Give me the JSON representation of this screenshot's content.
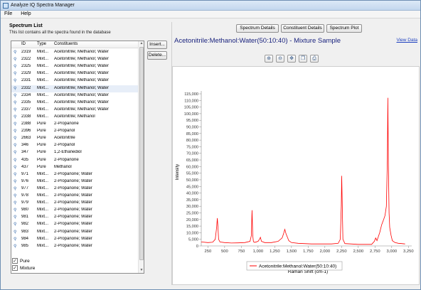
{
  "window": {
    "title": "Analyze IQ Spectra Manager"
  },
  "menu": [
    "File",
    "Help"
  ],
  "spectrum_list": {
    "header": "Spectrum List",
    "description": "This list contains all the spectra found in the database",
    "columns": [
      "ID",
      "Type",
      "Constituents"
    ],
    "rows": [
      {
        "id": "2319",
        "type": "Mixt...",
        "constituents": "Acetonitrile; Methanol; Water"
      },
      {
        "id": "2322",
        "type": "Mixt...",
        "constituents": "Acetonitrile; Methanol; Water"
      },
      {
        "id": "2325",
        "type": "Mixt...",
        "constituents": "Acetonitrile; Methanol; Water"
      },
      {
        "id": "2329",
        "type": "Mixt...",
        "constituents": "Acetonitrile; Methanol; Water"
      },
      {
        "id": "2331",
        "type": "Mixt...",
        "constituents": "Acetonitrile; Methanol; Water"
      },
      {
        "id": "2332",
        "type": "Mixt...",
        "constituents": "Acetonitrile; Methanol; Water"
      },
      {
        "id": "2334",
        "type": "Mixt...",
        "constituents": "Acetonitrile; Methanol; Water"
      },
      {
        "id": "2335",
        "type": "Mixt...",
        "constituents": "Acetonitrile; Methanol; Water"
      },
      {
        "id": "2337",
        "type": "Mixt...",
        "constituents": "Acetonitrile; Methanol; Water"
      },
      {
        "id": "2338",
        "type": "Mixt...",
        "constituents": "Acetonitrile; Methanol"
      },
      {
        "id": "2388",
        "type": "Pure",
        "constituents": "2-Propanone"
      },
      {
        "id": "2396",
        "type": "Pure",
        "constituents": "2-Propanol"
      },
      {
        "id": "2663",
        "type": "Pure",
        "constituents": "Acetonitrile"
      },
      {
        "id": "346",
        "type": "Pure",
        "constituents": "2-Propanol"
      },
      {
        "id": "347",
        "type": "Pure",
        "constituents": "1,2-Ethanediol"
      },
      {
        "id": "435",
        "type": "Pure",
        "constituents": "2-Propanone"
      },
      {
        "id": "437",
        "type": "Pure",
        "constituents": "Methanol"
      },
      {
        "id": "971",
        "type": "Mixt...",
        "constituents": "2-Propanone; Water"
      },
      {
        "id": "976",
        "type": "Mixt...",
        "constituents": "2-Propanone; Water"
      },
      {
        "id": "977",
        "type": "Mixt...",
        "constituents": "2-Propanone; Water"
      },
      {
        "id": "978",
        "type": "Mixt...",
        "constituents": "2-Propanone; Water"
      },
      {
        "id": "979",
        "type": "Mixt...",
        "constituents": "2-Propanone; Water"
      },
      {
        "id": "980",
        "type": "Mixt...",
        "constituents": "2-Propanone; Water"
      },
      {
        "id": "981",
        "type": "Mixt...",
        "constituents": "2-Propanone; Water"
      },
      {
        "id": "982",
        "type": "Mixt...",
        "constituents": "2-Propanone; Water"
      },
      {
        "id": "983",
        "type": "Mixt...",
        "constituents": "2-Propanone; Water"
      },
      {
        "id": "984",
        "type": "Mixt...",
        "constituents": "2-Propanone; Water"
      },
      {
        "id": "985",
        "type": "Mixt...",
        "constituents": "2-Propanone; Water"
      }
    ],
    "selected_id": "2332",
    "insert_button": "Insert...",
    "delete_button": "Delete...",
    "filters": [
      {
        "label": "Pure",
        "checked": true
      },
      {
        "label": "Mixture",
        "checked": true
      }
    ]
  },
  "tabs": [
    "Spectrum Details",
    "Constituent Details",
    "Spectrum Plot"
  ],
  "spectrum": {
    "title": "Acetonitrile:Methanol:Water(50:10:40) - Mixture Sample",
    "view_data_link": "View Data"
  },
  "toolbar_icons": [
    "zoom-in-icon",
    "zoom-out-icon",
    "pan-icon",
    "copy-icon",
    "print-icon"
  ],
  "chart_data": {
    "type": "line",
    "xlabel": "Raman Shift (cm-1)",
    "ylabel": "Intensity",
    "xlim": [
      150,
      3300
    ],
    "ylim": [
      0,
      115000
    ],
    "x_ticks": [
      "250",
      "500",
      "750",
      "1,000",
      "1,250",
      "1,500",
      "1,750",
      "2,000",
      "2,250",
      "2,500",
      "2,750",
      "3,000",
      "3,250"
    ],
    "y_ticks": [
      "0",
      "5,000",
      "10,000",
      "15,000",
      "20,000",
      "25,000",
      "30,000",
      "35,000",
      "40,000",
      "45,000",
      "50,000",
      "55,000",
      "60,000",
      "65,000",
      "70,000",
      "75,000",
      "80,000",
      "85,000",
      "90,000",
      "95,000",
      "100,000",
      "105,000",
      "110,000",
      "115,000"
    ],
    "grid": false,
    "legend_position": "bottom",
    "series": [
      {
        "name": "Acetonitrile:Methanol:Water(50:10:40)",
        "color": "#ff0000",
        "x": [
          150,
          250,
          320,
          360,
          380,
          390,
          400,
          410,
          430,
          500,
          600,
          700,
          800,
          880,
          900,
          910,
          920,
          930,
          940,
          960,
          1000,
          1020,
          1035,
          1050,
          1100,
          1200,
          1300,
          1360,
          1380,
          1400,
          1420,
          1440,
          1460,
          1500,
          1600,
          1800,
          2000,
          2100,
          2200,
          2230,
          2245,
          2252,
          2260,
          2270,
          2300,
          2500,
          2700,
          2740,
          2760,
          2780,
          2820,
          2850,
          2880,
          2900,
          2920,
          2935,
          2942,
          2950,
          2960,
          2970,
          2990,
          3010,
          3050,
          3100,
          3150,
          3200
        ],
        "y": [
          3000,
          2500,
          2800,
          5000,
          14000,
          21000,
          14000,
          5000,
          3000,
          2500,
          2200,
          2300,
          2500,
          3500,
          8000,
          27000,
          8000,
          3500,
          2800,
          2800,
          3500,
          5000,
          6500,
          3500,
          2500,
          2500,
          3500,
          6000,
          9000,
          12500,
          9000,
          6500,
          4000,
          2500,
          2000,
          1500,
          1500,
          1500,
          2000,
          5000,
          30000,
          53000,
          30000,
          5000,
          1800,
          1200,
          1200,
          3500,
          6000,
          4000,
          10000,
          16000,
          20000,
          23000,
          30000,
          65000,
          112000,
          65000,
          25000,
          14000,
          8000,
          4000,
          2500,
          2000,
          1800,
          1500
        ]
      }
    ]
  }
}
